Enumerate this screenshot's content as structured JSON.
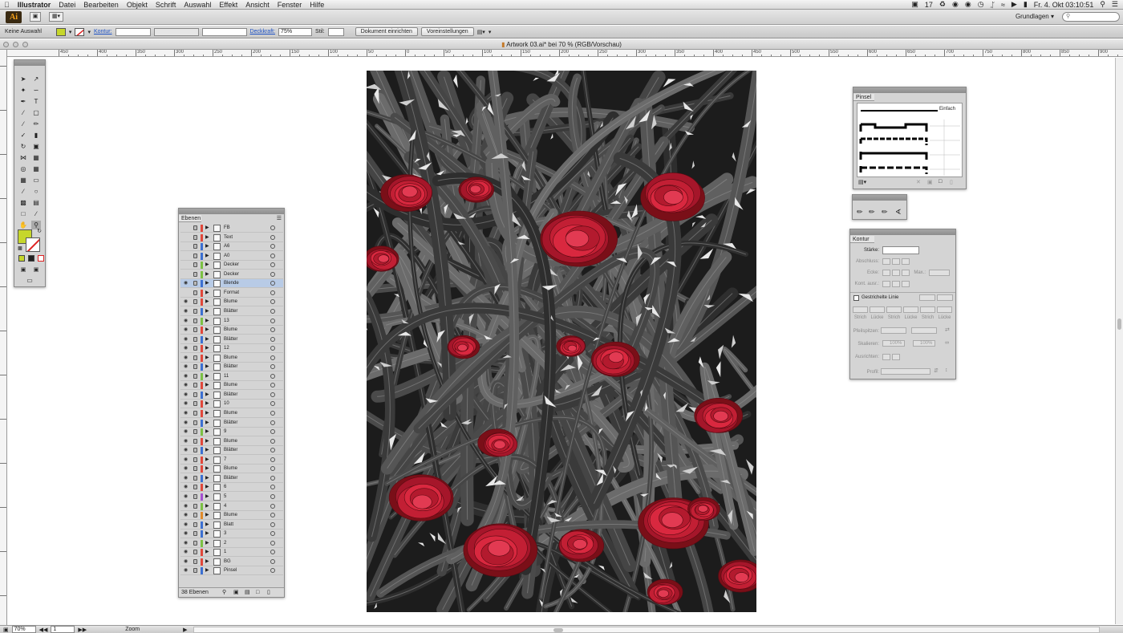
{
  "menubar": {
    "apple": "",
    "app": "Illustrator",
    "items": [
      "Datei",
      "Bearbeiten",
      "Objekt",
      "Schrift",
      "Auswahl",
      "Effekt",
      "Ansicht",
      "Fenster",
      "Hilfe"
    ],
    "status_count": "17",
    "datetime": "Fr. 4. Okt  03:10:51"
  },
  "appbar": {
    "logo": "Ai",
    "workspace": "Grundlagen",
    "search_placeholder": ""
  },
  "control_bar": {
    "selection": "Keine Auswahl",
    "fill_color": "#c6d62b",
    "stroke_label": "Kontur:",
    "opacity_label": "Deckkraft:",
    "opacity_value": "75%",
    "style_label": "Stil:",
    "document_setup_button": "Dokument einrichten",
    "preferences_button": "Voreinstellungen"
  },
  "document": {
    "title": "Artwork 03.ai* bei 70 % (RGB/Vorschau)"
  },
  "ruler": {
    "labels": [
      "450",
      "400",
      "350",
      "300",
      "250",
      "200",
      "150",
      "100",
      "50",
      "0",
      "50",
      "100",
      "150",
      "200",
      "250",
      "300",
      "350",
      "400",
      "450",
      "500",
      "550",
      "600",
      "650",
      "700",
      "750",
      "800",
      "850",
      "900",
      "950"
    ]
  },
  "layers_panel": {
    "title": "Ebenen",
    "count_label": "38 Ebenen",
    "layers": [
      {
        "name": "FB",
        "visible": false,
        "color": "#e0473a"
      },
      {
        "name": "Text",
        "visible": false,
        "color": "#e0473a"
      },
      {
        "name": "A6",
        "visible": false,
        "color": "#3b6fd1"
      },
      {
        "name": "A0",
        "visible": false,
        "color": "#3b6fd1"
      },
      {
        "name": "Decker",
        "visible": false,
        "color": "#7bc043"
      },
      {
        "name": "Decker",
        "visible": false,
        "color": "#7bc043"
      },
      {
        "name": "Blende",
        "visible": true,
        "color": "#3b6fd1",
        "selected": true
      },
      {
        "name": "Format",
        "visible": false,
        "color": "#e0473a"
      },
      {
        "name": "Blume",
        "visible": true,
        "color": "#e0473a"
      },
      {
        "name": "Blätter",
        "visible": true,
        "color": "#3b6fd1"
      },
      {
        "name": "13",
        "visible": true,
        "color": "#7bc043"
      },
      {
        "name": "Blume",
        "visible": true,
        "color": "#e0473a"
      },
      {
        "name": "Blätter",
        "visible": true,
        "color": "#3b6fd1"
      },
      {
        "name": "12",
        "visible": true,
        "color": "#e0473a"
      },
      {
        "name": "Blume",
        "visible": true,
        "color": "#e0473a"
      },
      {
        "name": "Blätter",
        "visible": true,
        "color": "#3b6fd1"
      },
      {
        "name": "11",
        "visible": true,
        "color": "#7bc043"
      },
      {
        "name": "Blume",
        "visible": true,
        "color": "#e0473a"
      },
      {
        "name": "Blätter",
        "visible": true,
        "color": "#3b6fd1"
      },
      {
        "name": "10",
        "visible": true,
        "color": "#e0473a"
      },
      {
        "name": "Blume",
        "visible": true,
        "color": "#e0473a"
      },
      {
        "name": "Blätter",
        "visible": true,
        "color": "#3b6fd1"
      },
      {
        "name": "9",
        "visible": true,
        "color": "#7bc043"
      },
      {
        "name": "Blume",
        "visible": true,
        "color": "#e0473a"
      },
      {
        "name": "Blätter",
        "visible": true,
        "color": "#3b6fd1"
      },
      {
        "name": "7",
        "visible": true,
        "color": "#e0473a"
      },
      {
        "name": "Blume",
        "visible": true,
        "color": "#e0473a"
      },
      {
        "name": "Blätter",
        "visible": true,
        "color": "#3b6fd1"
      },
      {
        "name": "6",
        "visible": true,
        "color": "#e0473a"
      },
      {
        "name": "5",
        "visible": true,
        "color": "#a44fd1"
      },
      {
        "name": "4",
        "visible": true,
        "color": "#7bc043"
      },
      {
        "name": "Blume",
        "visible": true,
        "color": "#e08a2a"
      },
      {
        "name": "Blatt",
        "visible": true,
        "color": "#3b6fd1"
      },
      {
        "name": "3",
        "visible": true,
        "color": "#3b6fd1"
      },
      {
        "name": "2",
        "visible": true,
        "color": "#7bc043"
      },
      {
        "name": "1",
        "visible": true,
        "color": "#e0473a"
      },
      {
        "name": "BG",
        "visible": true,
        "color": "#e0473a"
      },
      {
        "name": "Pinsel",
        "visible": true,
        "color": "#3b6fd1"
      }
    ]
  },
  "brushes_panel": {
    "title": "Pinsel",
    "first_brush": "Einfach"
  },
  "stroke_panel": {
    "title": "Kontur",
    "weight_label": "Stärke:",
    "cap_label": "Abschluss:",
    "corner_label": "Ecke:",
    "limit_label": "Max.:",
    "align_label": "Kont. ausr.:",
    "dashed_label": "Gestrichelte Linie",
    "dash_labels": [
      "Strich",
      "Lücke",
      "Strich",
      "Lücke",
      "Strich",
      "Lücke"
    ],
    "arrowheads_label": "Pfeilspitzen:",
    "scale_label": "Skalieren:",
    "scale_value": "100%",
    "align_arrows_label": "Ausrichten:",
    "profile_label": "Profil:"
  },
  "statusbar": {
    "zoom": "70%",
    "page": "1",
    "tool": "Zoom"
  }
}
